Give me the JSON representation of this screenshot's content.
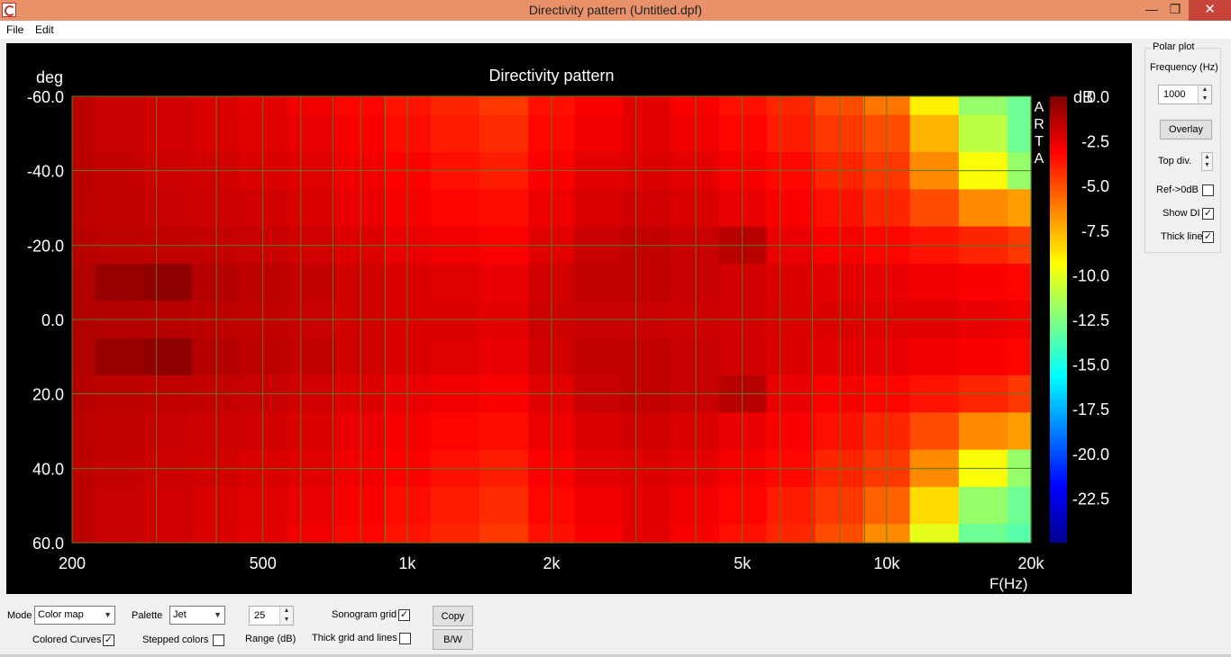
{
  "window": {
    "title": "Directivity pattern (Untitled.dpf)",
    "minimize_glyph": "—",
    "restore_glyph": "❐",
    "close_glyph": "✕"
  },
  "menu": {
    "file": "File",
    "edit": "Edit"
  },
  "chart_data": {
    "type": "heatmap",
    "title": "Directivity pattern",
    "xlabel": "F(Hz)",
    "ylabel": "deg",
    "x_scale": "log",
    "xlim": [
      200,
      20000
    ],
    "ylim": [
      -60,
      60
    ],
    "x_ticks": [
      200,
      500,
      1000,
      2000,
      5000,
      10000,
      20000
    ],
    "x_tick_labels": [
      "200",
      "500",
      "1k",
      "2k",
      "5k",
      "10k",
      "20k"
    ],
    "y_ticks": [
      -60,
      -40,
      -20,
      0,
      20,
      40,
      60
    ],
    "y_tick_labels": [
      "-60.0",
      "-40.0",
      "-20.0",
      "0.0",
      "20.0",
      "40.0",
      "60.0"
    ],
    "colorbar": {
      "label": "dB",
      "palette": "Jet",
      "range_db": [
        -25,
        0
      ],
      "ticks": [
        0,
        -2.5,
        -5,
        -7.5,
        -10,
        -12.5,
        -15,
        -17.5,
        -20,
        -22.5
      ],
      "tick_labels": [
        "0.0",
        "-2.5",
        "-5.0",
        "-7.5",
        "-10.0",
        "-12.5",
        "-15.0",
        "-17.5",
        "-20.0",
        "-22.5"
      ]
    },
    "watermark": "ARTA",
    "grid": true,
    "z_samples": {
      "frequencies_hz": [
        200,
        250,
        315,
        400,
        500,
        630,
        800,
        1000,
        1250,
        1600,
        2000,
        2500,
        3150,
        4000,
        5000,
        6300,
        8000,
        10000,
        12500,
        16000,
        20000
      ],
      "angles_deg": [
        -60,
        -50,
        -40,
        -30,
        -20,
        -10,
        0,
        10,
        20,
        30,
        40,
        50,
        60
      ],
      "db": [
        [
          -1.5,
          -1.8,
          -2,
          -2.2,
          -2.5,
          -2.8,
          -3.2,
          -3.6,
          -4,
          -4.5,
          -3.5,
          -3,
          -2.5,
          -3,
          -3.5,
          -4,
          -5,
          -6,
          -9,
          -12,
          -13
        ],
        [
          -1.5,
          -1.8,
          -2,
          -2.2,
          -2.4,
          -2.6,
          -3,
          -3.4,
          -3.8,
          -4.2,
          -3.3,
          -2.8,
          -2.5,
          -2.8,
          -3.2,
          -3.8,
          -4.5,
          -5,
          -7.5,
          -11,
          -13
        ],
        [
          -1.5,
          -1.7,
          -1.9,
          -2,
          -2.2,
          -2.4,
          -2.8,
          -3.1,
          -3.5,
          -3.8,
          -3,
          -2.5,
          -2.3,
          -2.5,
          -2.9,
          -3.3,
          -4,
          -4.5,
          -6.5,
          -9.5,
          -12
        ],
        [
          -1.5,
          -1.6,
          -1.8,
          -1.9,
          -2,
          -2.2,
          -2.6,
          -2.9,
          -3.2,
          -3.4,
          -2.7,
          -2.2,
          -2,
          -2.2,
          -2.6,
          -3,
          -3.5,
          -4,
          -5,
          -6.5,
          -7
        ],
        [
          -1.4,
          -1.5,
          -1.6,
          -1.7,
          -1.8,
          -2,
          -2.3,
          -2.6,
          -2.8,
          -3,
          -2.4,
          -1.8,
          -1.6,
          -1.8,
          -1.4,
          -2.6,
          -3,
          -3.2,
          -3.6,
          -4,
          -4.5
        ],
        [
          -1.2,
          -0.6,
          -0.4,
          -1.3,
          -1.5,
          -1.7,
          -2,
          -2.2,
          -2.4,
          -2.6,
          -2,
          -1.6,
          -1.6,
          -1.8,
          -2,
          -2.3,
          -2.5,
          -2.6,
          -2.8,
          -3,
          -3.2
        ],
        [
          -1.2,
          -1.3,
          -1.4,
          -1.5,
          -1.6,
          -1.8,
          -2,
          -2.2,
          -2.3,
          -2.5,
          -1.9,
          -1.8,
          -1.8,
          -1.9,
          -2,
          -2.2,
          -2.3,
          -2.4,
          -2.5,
          -2.6,
          -2.8
        ],
        [
          -1.2,
          -0.6,
          -0.4,
          -1.3,
          -1.5,
          -1.7,
          -2,
          -2.2,
          -2.4,
          -2.6,
          -2,
          -1.6,
          -1.6,
          -1.8,
          -2,
          -2.3,
          -2.5,
          -2.6,
          -2.8,
          -3,
          -3.2
        ],
        [
          -1.4,
          -1.5,
          -1.6,
          -1.7,
          -1.8,
          -2,
          -2.3,
          -2.6,
          -2.8,
          -3,
          -2.4,
          -1.8,
          -1.6,
          -1.8,
          -1.4,
          -2.6,
          -3,
          -3.2,
          -3.6,
          -4,
          -4.5
        ],
        [
          -1.5,
          -1.6,
          -1.8,
          -1.9,
          -2,
          -2.2,
          -2.6,
          -2.9,
          -3.2,
          -3.4,
          -2.7,
          -2.2,
          -2,
          -2.2,
          -2.6,
          -3,
          -3.5,
          -4,
          -5,
          -6.5,
          -7
        ],
        [
          -1.5,
          -1.7,
          -1.9,
          -2,
          -2.2,
          -2.4,
          -2.8,
          -3.1,
          -3.5,
          -3.8,
          -3,
          -2.5,
          -2.3,
          -2.5,
          -2.9,
          -3.3,
          -4,
          -4.5,
          -6.5,
          -9.5,
          -12
        ],
        [
          -1.5,
          -1.8,
          -2,
          -2.2,
          -2.4,
          -2.6,
          -3,
          -3.4,
          -3.8,
          -4.2,
          -3.3,
          -2.8,
          -2.5,
          -2.8,
          -3.2,
          -3.8,
          -4.5,
          -5.5,
          -8.5,
          -12,
          -13
        ],
        [
          -1.5,
          -1.8,
          -2,
          -2.2,
          -2.5,
          -2.8,
          -3.2,
          -3.6,
          -4,
          -4.5,
          -3.5,
          -3,
          -2.5,
          -3,
          -3.5,
          -4,
          -5,
          -6.5,
          -10,
          -13,
          -13.5
        ]
      ]
    }
  },
  "polar_plot": {
    "title": "Polar plot",
    "frequency_label": "Frequency (Hz)",
    "frequency_value": "1000",
    "overlay_label": "Overlay",
    "top_div_label": "Top div.",
    "ref_label": "Ref->0dB",
    "ref_checked": false,
    "show_di_label": "Show DI",
    "show_di_checked": true,
    "thick_line_label": "Thick line",
    "thick_line_checked": true
  },
  "bottom": {
    "mode_label": "Mode",
    "mode_value": "Color map",
    "palette_label": "Palette",
    "palette_value": "Jet",
    "range_value": "25",
    "range_label": "Range (dB)",
    "sonogram_grid_label": "Sonogram grid",
    "sonogram_grid_checked": true,
    "colored_curves_label": "Colored Curves",
    "colored_curves_checked": true,
    "stepped_colors_label": "Stepped colors",
    "stepped_colors_checked": false,
    "thick_grid_label": "Thick grid and  lines",
    "thick_grid_checked": false,
    "copy_label": "Copy",
    "bw_label": "B/W"
  }
}
